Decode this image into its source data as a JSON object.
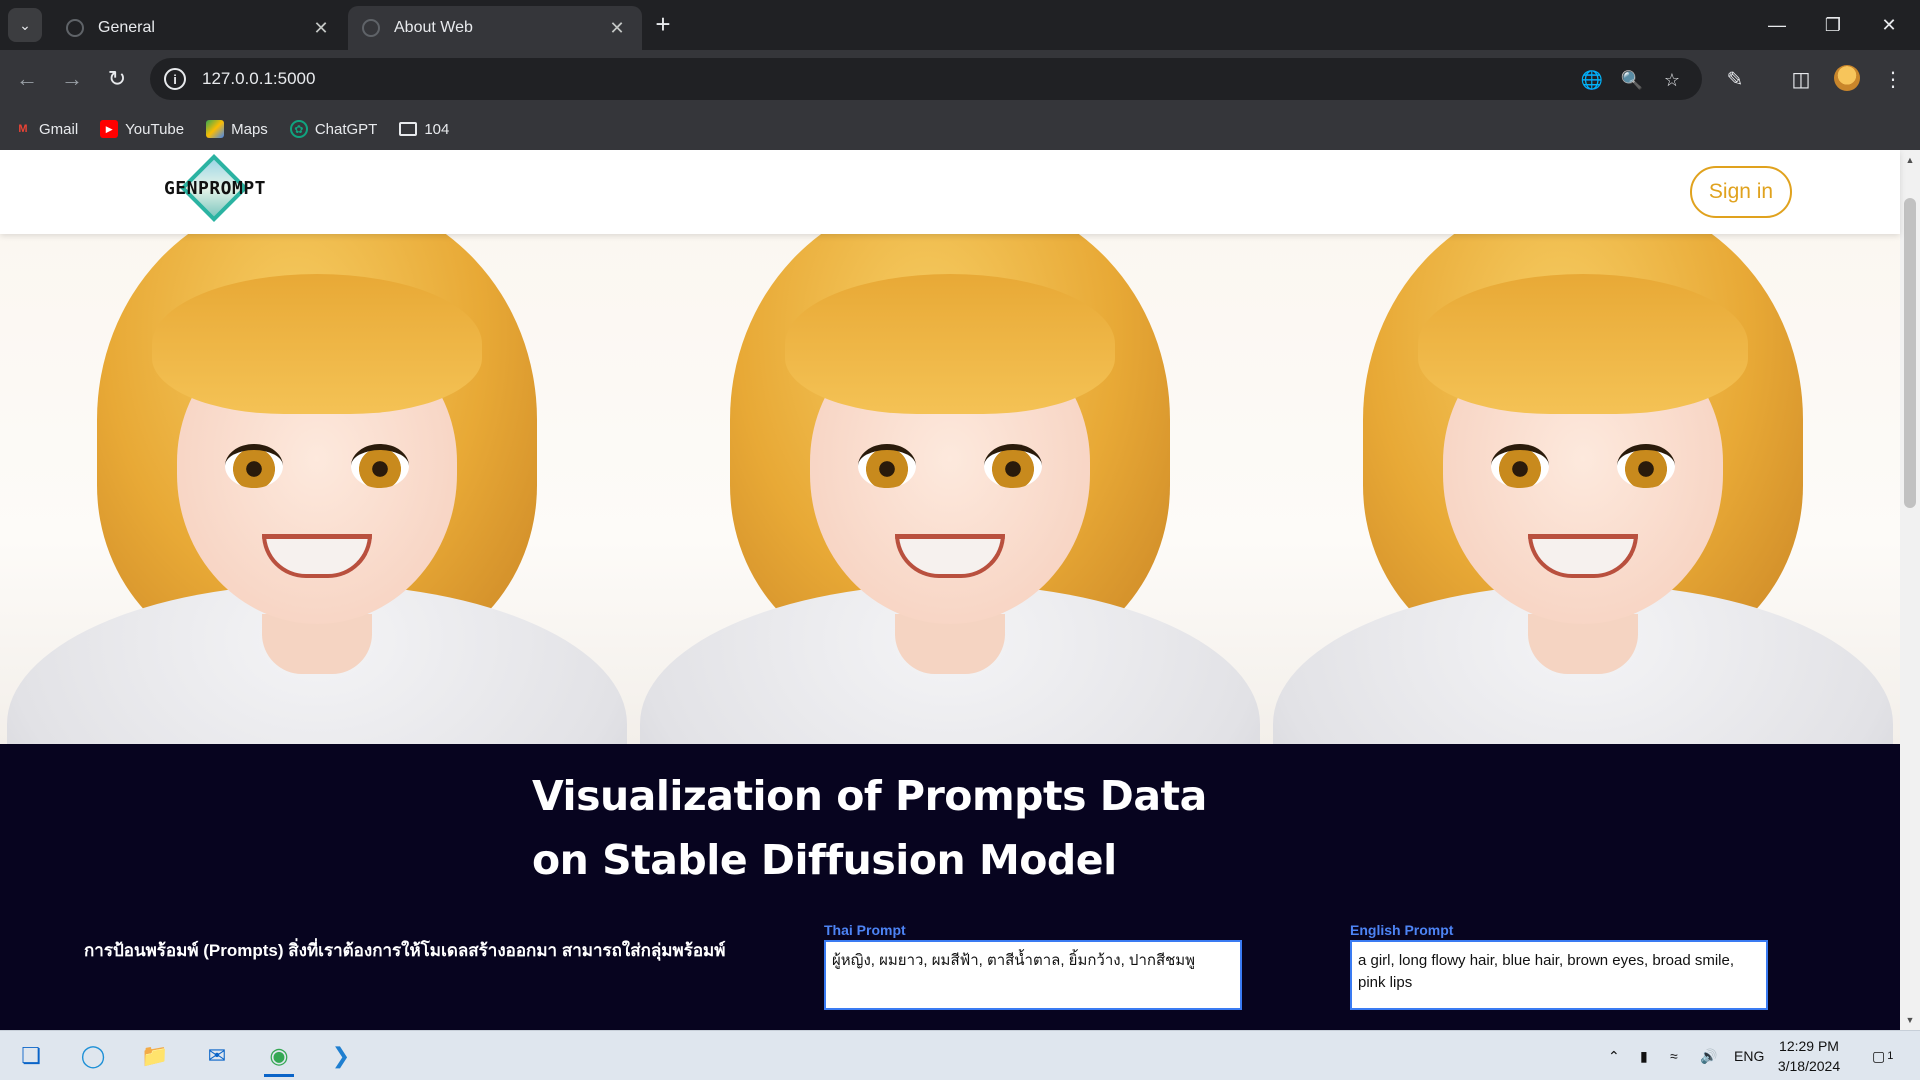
{
  "browser": {
    "tabs": [
      {
        "label": "General",
        "active": false
      },
      {
        "label": "About Web",
        "active": true
      }
    ],
    "url": "127.0.0.1:5000",
    "bookmarks": [
      {
        "label": "Gmail",
        "icon": "gmail-icon",
        "color": "#ea4335"
      },
      {
        "label": "YouTube",
        "icon": "youtube-icon",
        "color": "#ff0000"
      },
      {
        "label": "Maps",
        "icon": "maps-icon",
        "color": "#34a853"
      },
      {
        "label": "ChatGPT",
        "icon": "chatgpt-icon",
        "color": "#10a37f"
      },
      {
        "label": "104",
        "icon": "folder-icon",
        "color": "#e8eaed"
      }
    ]
  },
  "site": {
    "logo_text": "GENPROMPT",
    "signin_label": "Sign in",
    "accent_color": "#e0a21e",
    "hero_images": 3,
    "headline_line1": "Visualization of Prompts Data",
    "headline_line2": "on Stable Diffusion Model",
    "description": "การป้อนพร้อมพ์ (Prompts) สิ่งที่เราต้องการให้โมเดลสร้างออกมา สามารถใส่กลุ่มพร้อมพ์",
    "thai_prompt": {
      "label": "Thai Prompt",
      "value": "ผู้หญิง, ผมยาว, ผมสีฟ้า, ตาสีน้ำตาล, ยิ้มกว้าง, ปากสีชมพู"
    },
    "english_prompt": {
      "label": "English Prompt",
      "value": "a girl, long flowy hair, blue hair, brown eyes, broad smile, pink lips"
    },
    "dark_bg": "#07041f"
  },
  "taskbar": {
    "language": "ENG",
    "time": "12:29 PM",
    "date": "3/18/2024",
    "notification_count": "1"
  }
}
